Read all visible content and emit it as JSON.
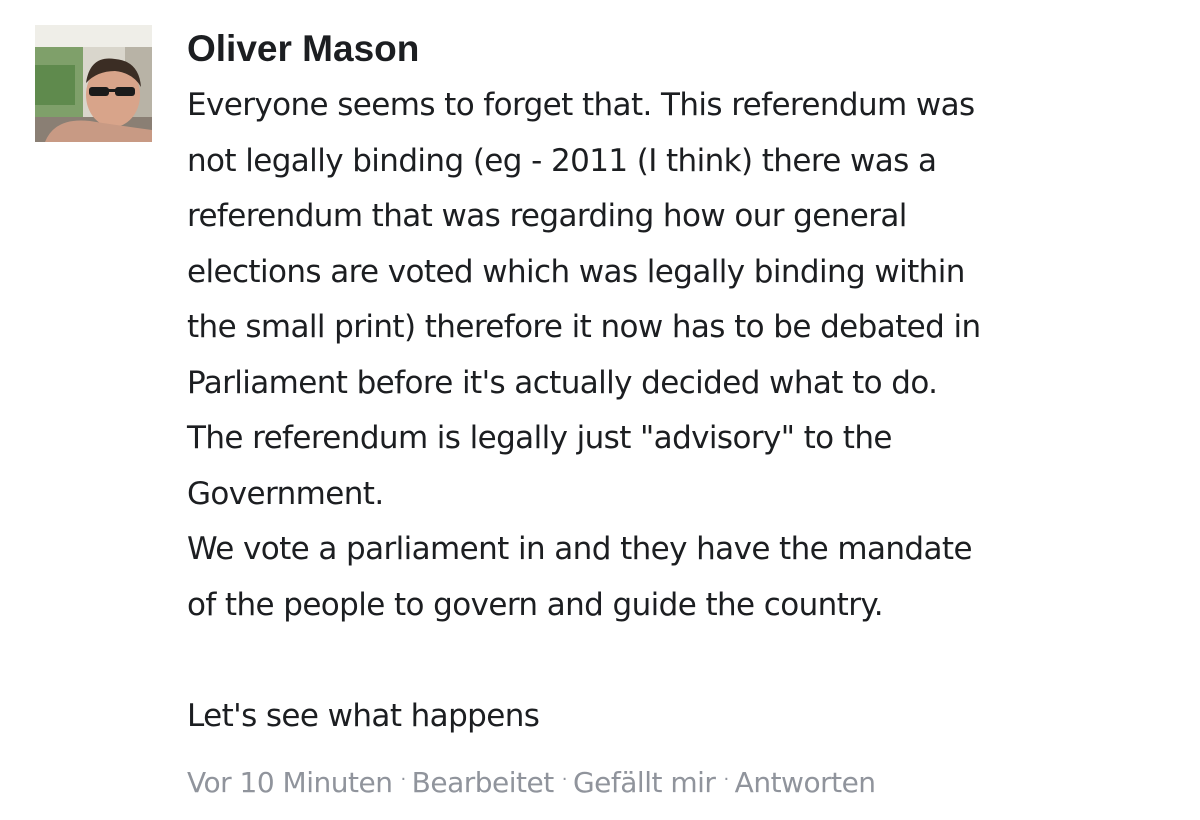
{
  "comment": {
    "author": "Oliver Mason",
    "lines": [
      "Everyone seems to forget that. This referendum was",
      "not legally binding (eg - 2011 (I think) there was a",
      "referendum that was regarding how our general",
      "elections are voted which was legally binding within",
      "the small print) therefore it now has to be debated in",
      "Parliament before it's actually decided what to do.",
      "The referendum is legally just \"advisory\" to the",
      "Government.",
      "We vote a parliament in and they have the mandate",
      "of the people to govern and guide the country.",
      "",
      "Let's see what happens"
    ],
    "meta": {
      "time": "Vor 10 Minuten",
      "edited": "Bearbeitet",
      "like": "Gefällt mir",
      "reply": "Antworten",
      "separator": "·"
    }
  },
  "colors": {
    "text": "#1c1e21",
    "meta": "#90949c"
  }
}
